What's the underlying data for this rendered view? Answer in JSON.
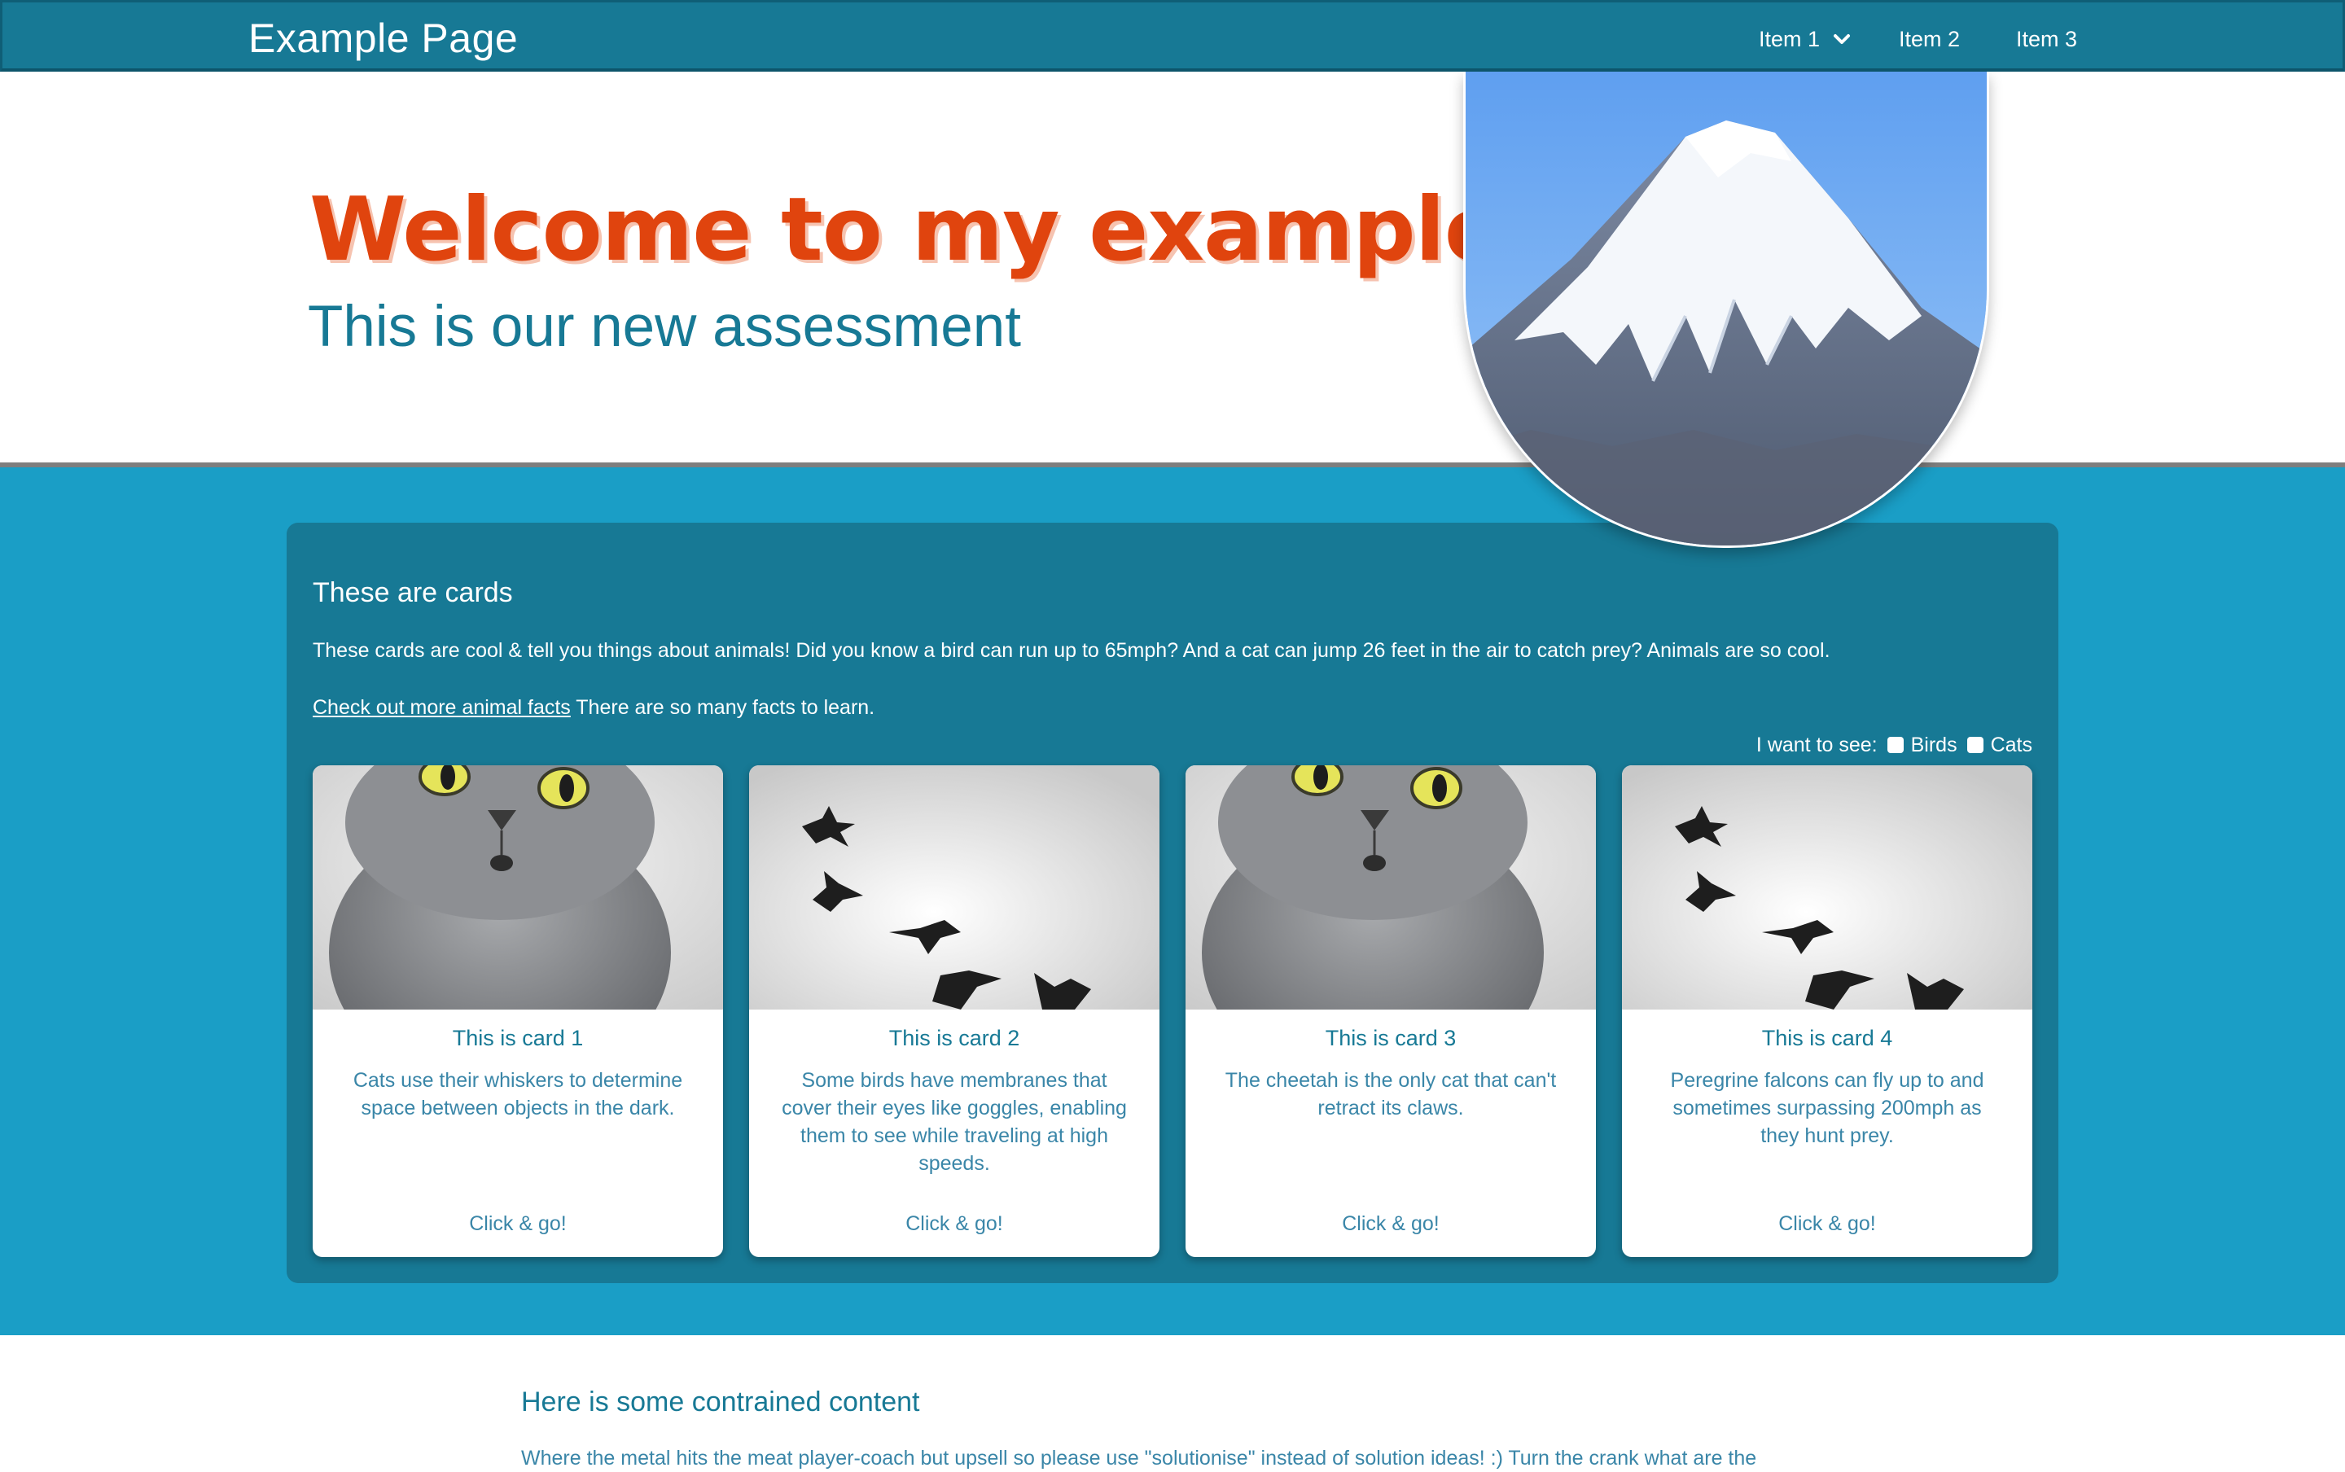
{
  "nav": {
    "brand": "Example Page",
    "items": [
      {
        "label": "Item 1",
        "has_dropdown": true
      },
      {
        "label": "Item 2",
        "has_dropdown": false
      },
      {
        "label": "Item 3",
        "has_dropdown": false
      }
    ]
  },
  "hero": {
    "title": "Welcome to my example page",
    "subtitle": "This is our new assessment"
  },
  "cards_section": {
    "title": "These are cards",
    "description": "These cards are cool & tell you things about animals! Did you know a bird can run up to 65mph? And a cat can jump 26 feet in the air to catch prey? Animals are so cool.",
    "link_text": "Check out more animal facts",
    "link_suffix": " There are so many facts to learn.",
    "filter": {
      "label": "I want to see:",
      "options": [
        {
          "label": "Birds",
          "checked": false
        },
        {
          "label": "Cats",
          "checked": false
        }
      ]
    },
    "cards": [
      {
        "image": "cat-photo",
        "title": "This is card 1",
        "text": "Cats use their whiskers to determine space between objects in the dark.",
        "link": "Click & go!"
      },
      {
        "image": "birds-photo",
        "title": "This is card 2",
        "text": "Some birds have membranes that cover their eyes like goggles, enabling them to see while traveling at high speeds.",
        "link": "Click & go!"
      },
      {
        "image": "cat-photo",
        "title": "This is card 3",
        "text": "The cheetah is the only cat that can't retract its claws.",
        "link": "Click & go!"
      },
      {
        "image": "birds-photo",
        "title": "This is card 4",
        "text": "Peregrine falcons can fly up to and sometimes surpassing 200mph as they hunt prey.",
        "link": "Click & go!"
      }
    ]
  },
  "constrained": {
    "title": "Here is some contrained content",
    "text": "Where the metal hits the meat player-coach but upsell so please use \"solutionise\" instead of solution ideas! :) Turn the crank what are the"
  },
  "colors": {
    "nav_bg": "#177995",
    "accent_orange": "#e0440e",
    "teal_text": "#177995",
    "section_bg": "#1a9ec6"
  }
}
